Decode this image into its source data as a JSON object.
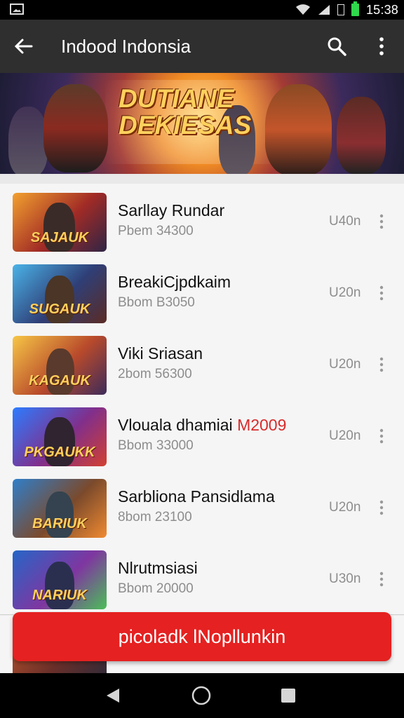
{
  "status_bar": {
    "time": "15:38"
  },
  "app_bar": {
    "title": "Indood Indonsia"
  },
  "banner": {
    "title": "DUTIANE DEKIESAS"
  },
  "list": {
    "items": [
      {
        "title": "Sarllay Rundar",
        "subtitle": "Pbem 34300",
        "meta": "U40n",
        "thumb_label": "SAJAUK",
        "colors": [
          "#f3a12e",
          "#a12b26",
          "#2f2445"
        ]
      },
      {
        "title": "BreakiCjpdkaim",
        "subtitle": "Bbom B3050",
        "meta": "U20n",
        "thumb_label": "SUGAUK",
        "colors": [
          "#4ab3e8",
          "#2f3f77",
          "#5b2b24"
        ]
      },
      {
        "title": "Viki Sriasan",
        "subtitle": "2bom 56300",
        "meta": "U20n",
        "thumb_label": "KAGAUK",
        "colors": [
          "#f7c646",
          "#b84a2b",
          "#3d2b5a"
        ]
      },
      {
        "title": "Vlouala dhamiai",
        "title_accent": "M2009",
        "subtitle": "Bbom 33000",
        "meta": "U20n",
        "thumb_label": "PKGAUKK",
        "colors": [
          "#2c7cff",
          "#812f8b",
          "#d24030"
        ]
      },
      {
        "title": "Sarbliona Pansidlama",
        "subtitle": "8bom 23100",
        "meta": "U20n",
        "thumb_label": "BARIUK",
        "colors": [
          "#2f7fca",
          "#7b4a2c",
          "#f08a30"
        ]
      },
      {
        "title": "Nlrutmsiasi",
        "subtitle": "Bbom 20000",
        "meta": "U30n",
        "thumb_label": "NARIUK",
        "colors": [
          "#2566c8",
          "#7f36a0",
          "#4bbf58"
        ]
      }
    ]
  },
  "fab": {
    "label": "picoladk lNopllunkin"
  },
  "colors": {
    "accent_red": "#e52121",
    "app_bar": "#2f2f2f",
    "list_bg": "#f5f5f5"
  }
}
